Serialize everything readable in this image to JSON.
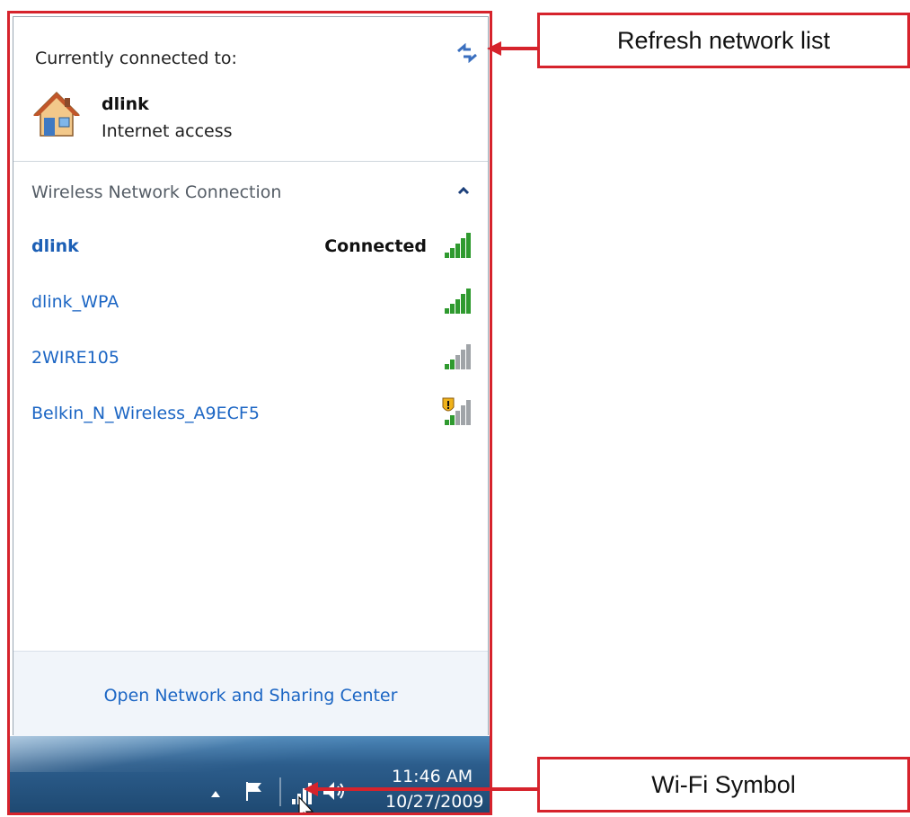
{
  "flyout": {
    "currently_connected_label": "Currently connected to:",
    "current_network": {
      "name": "dlink",
      "status": "Internet access"
    },
    "section_title": "Wireless Network Connection",
    "networks": [
      {
        "name": "dlink",
        "status": "Connected",
        "signal_bars": 5,
        "secured_warning": false
      },
      {
        "name": "dlink_WPA",
        "status": "",
        "signal_bars": 5,
        "secured_warning": false
      },
      {
        "name": "2WIRE105",
        "status": "",
        "signal_bars": 2,
        "secured_warning": false
      },
      {
        "name": "Belkin_N_Wireless_A9ECF5",
        "status": "",
        "signal_bars": 2,
        "secured_warning": true
      }
    ],
    "footer_link": "Open Network and Sharing Center"
  },
  "taskbar": {
    "time": "11:46 AM",
    "date": "10/27/2009"
  },
  "callouts": {
    "refresh": "Refresh network list",
    "wifi": "Wi-Fi Symbol"
  },
  "colors": {
    "annotation_red": "#d6232c",
    "link_blue": "#1c66c4",
    "signal_green": "#2f9a2f",
    "signal_gray": "#a0a4a8"
  }
}
